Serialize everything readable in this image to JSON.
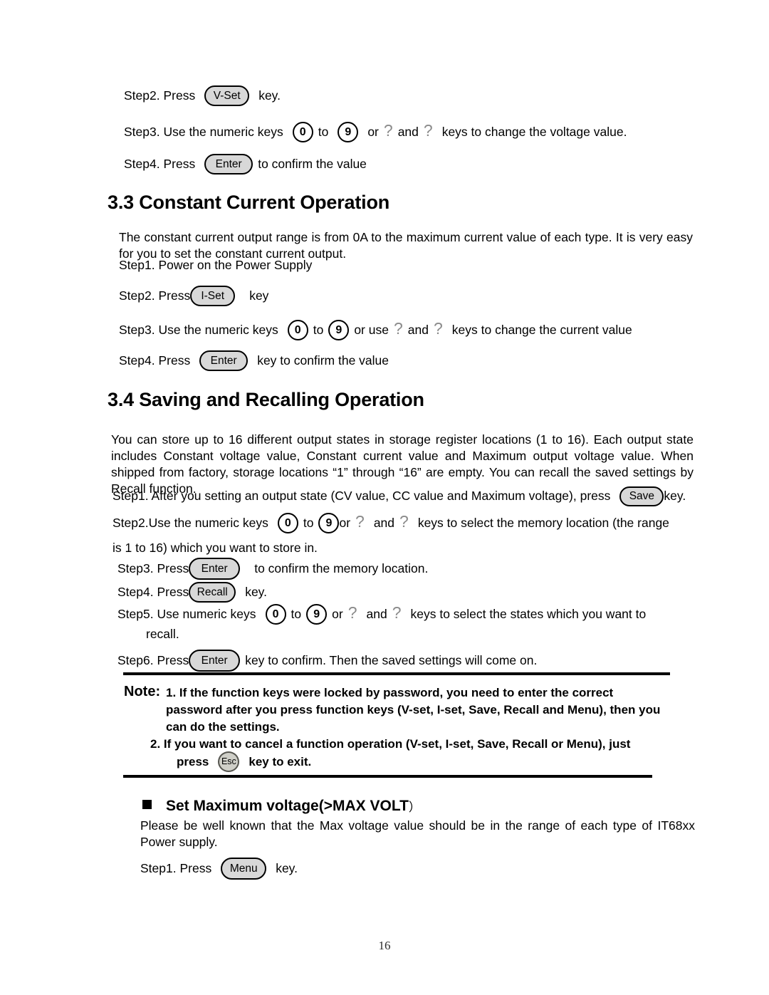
{
  "document": {
    "page_number": "16"
  },
  "intro_steps": {
    "step2": {
      "prefix": "Step2. Press",
      "key": "V-Set",
      "suffix": "key."
    },
    "step3": {
      "prefix": "Step3. Use the numeric keys",
      "key_from": "0",
      "mid": "to",
      "key_to": "9",
      "conj1": "or",
      "q1": "?",
      "conj2": "and",
      "q2": "?",
      "suffix": "keys to change the voltage value."
    },
    "step4": {
      "prefix": "Step4. Press",
      "key": "Enter",
      "suffix": "to confirm the value"
    }
  },
  "section_33": {
    "heading": "3.3 Constant Current Operation",
    "paragraph": "The constant current output range is from 0A to the maximum current value of each type. It is very easy for you to set the constant current output.",
    "step1": "Step1. Power on the Power Supply",
    "step2": {
      "prefix": "Step2. Press",
      "key": "I-Set",
      "suffix": "key"
    },
    "step3": {
      "prefix": "Step3. Use the numeric keys",
      "key_from": "0",
      "mid": "to",
      "key_to": "9",
      "conj1": "or use",
      "q1": "?",
      "conj2": "and",
      "q2": "?",
      "suffix": "keys to change the current value"
    },
    "step4": {
      "prefix": "Step4. Press",
      "key": "Enter",
      "suffix": "key to confirm the value"
    }
  },
  "section_34": {
    "heading": "3.4 Saving and Recalling Operation",
    "paragraph": "You can store up to 16 different output states in storage register locations (1 to 16). Each output state includes Constant voltage value, Constant current value and Maximum output voltage value. When shipped from factory, storage locations “1” through “16” are empty. You can recall the saved settings by Recall function.",
    "step1": {
      "prefix": "Step1. After you setting an output state (CV value, CC value and Maximum voltage), press",
      "key": "Save",
      "suffix": "key."
    },
    "step2": {
      "prefix": "Step2.Use the numeric keys",
      "key_from": "0",
      "mid": "to",
      "key_to": "9",
      "conj1": "or",
      "q1": "?",
      "conj2": "and",
      "q2": "?",
      "suffix": "keys to select the memory location (the range",
      "wrap": "is 1 to 16) which you want to store in."
    },
    "step3": {
      "prefix": "Step3. Press",
      "key": "Enter",
      "suffix": "to confirm the memory location."
    },
    "step4": {
      "prefix": "Step4. Press",
      "key": "Recall",
      "suffix": "key."
    },
    "step5": {
      "prefix": "Step5. Use numeric keys",
      "key_from": "0",
      "mid": "to",
      "key_to": "9",
      "conj1": "or",
      "q1": "?",
      "conj2": "and",
      "q2": "?",
      "suffix": "keys to select the states which you want to",
      "wrap": "recall."
    },
    "step6": {
      "prefix": "Step6. Press",
      "key": "Enter",
      "suffix": "key to confirm. Then the saved settings will come on."
    }
  },
  "note": {
    "label": "Note:",
    "item1": "1. If the function keys were locked by password, you need to enter the correct password after you press function keys (V-set, I-set, Save, Recall and Menu), then you can do the settings.",
    "item2_pre": "2. If you want to cancel a function operation (V-set, I-set, Save, Recall or Menu), just",
    "item2_press": "press",
    "item2_key": "Esc",
    "item2_post": "key to exit."
  },
  "max_volt": {
    "heading_main": "Set Maximum voltage(>MAX VOLT",
    "heading_paren": "）",
    "paragraph": "Please be well known that the Max voltage value should be in the range of each type of IT68xx Power supply.",
    "step1": {
      "prefix": "Step1. Press",
      "key": "Menu",
      "suffix": "key."
    }
  }
}
